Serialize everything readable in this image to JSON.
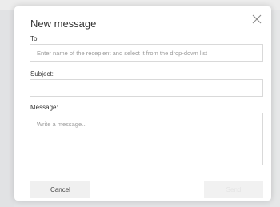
{
  "dialog": {
    "title": "New message"
  },
  "to": {
    "label": "To:",
    "placeholder": "Enter name of the recepient and select it from the drop-down list",
    "value": ""
  },
  "subject": {
    "label": "Subject:",
    "placeholder": "",
    "value": ""
  },
  "message": {
    "label": "Message:",
    "placeholder": "Write a message...",
    "value": ""
  },
  "buttons": {
    "cancel_label": "Cancel",
    "send_label": "Send",
    "send_enabled": false
  },
  "icons": {
    "close": "close-icon"
  },
  "colors": {
    "backdrop": "#e3e4e6",
    "dialog_bg": "#ffffff",
    "text": "#333333",
    "border": "#d9d9d9",
    "button_bg": "#f0f0f0"
  }
}
